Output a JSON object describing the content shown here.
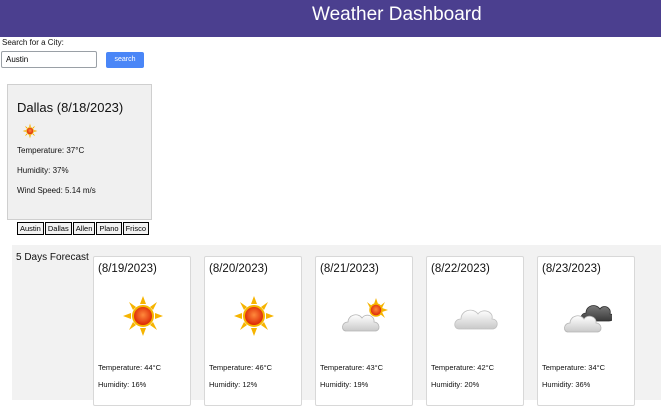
{
  "header": {
    "title": "Weather Dashboard"
  },
  "search": {
    "label": "Search for a City:",
    "value": "Austin",
    "button_label": "search"
  },
  "current": {
    "title": "Dallas (8/18/2023)",
    "icon": "sun-icon",
    "temperature": "Temperature: 37°C",
    "humidity": "Humidity: 37%",
    "wind": "Wind Speed: 5.14 m/s"
  },
  "history": [
    "Austin",
    "Dallas",
    "Allen",
    "Plano",
    "Frisco"
  ],
  "forecast": {
    "heading": "5 Days Forecast",
    "days": [
      {
        "date": "(8/19/2023)",
        "icon": "sun-icon",
        "temperature": "Temperature: 44°C",
        "humidity": "Humidity: 16%"
      },
      {
        "date": "(8/20/2023)",
        "icon": "sun-icon",
        "temperature": "Temperature: 46°C",
        "humidity": "Humidity: 12%"
      },
      {
        "date": "(8/21/2023)",
        "icon": "partly-cloudy-icon",
        "temperature": "Temperature: 43°C",
        "humidity": "Humidity: 19%"
      },
      {
        "date": "(8/22/2023)",
        "icon": "cloud-icon",
        "temperature": "Temperature: 42°C",
        "humidity": "Humidity: 20%"
      },
      {
        "date": "(8/23/2023)",
        "icon": "broken-clouds-icon",
        "temperature": "Temperature: 34°C",
        "humidity": "Humidity: 36%"
      }
    ]
  },
  "colors": {
    "header_bg": "#4b3f8f",
    "button_bg": "#4a86f7",
    "card_bg": "#f0f0f0",
    "forecast_bg": "#f2f2f2"
  }
}
